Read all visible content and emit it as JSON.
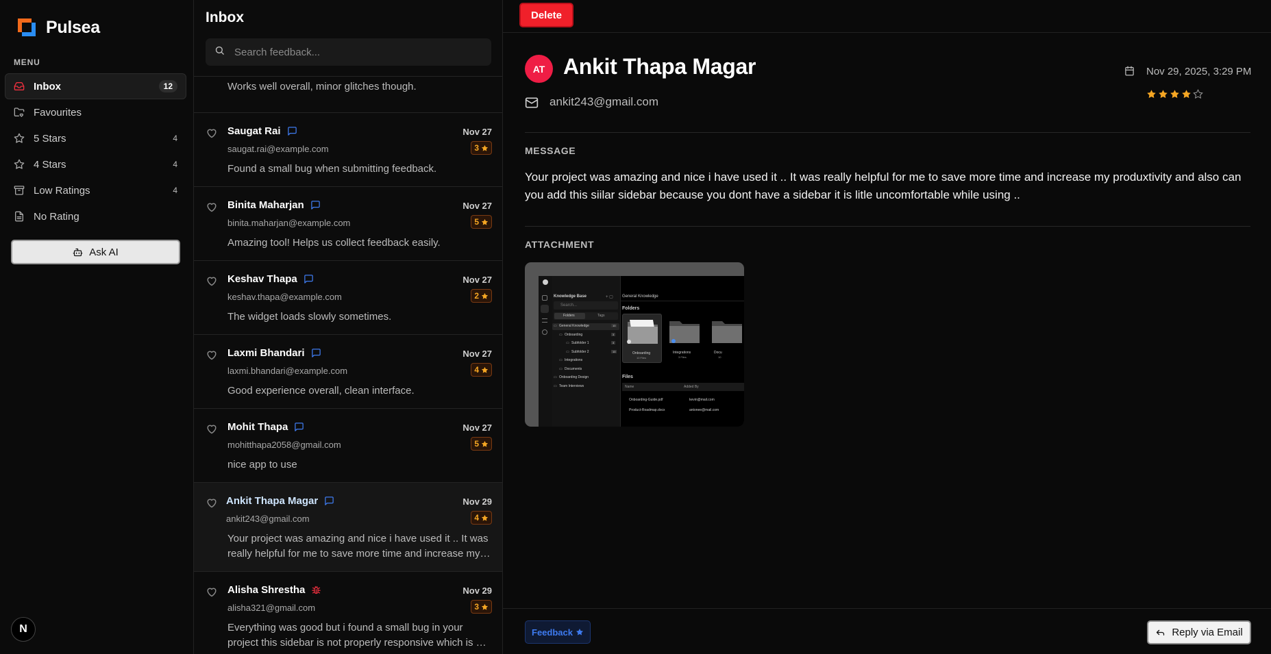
{
  "brand": {
    "name": "Pulsea"
  },
  "sidebar": {
    "menu_label": "MENU",
    "items": [
      {
        "label": "Inbox",
        "count": "12",
        "icon": "inbox-icon",
        "active": true
      },
      {
        "label": "Favourites",
        "count": "",
        "icon": "folder-heart-icon"
      },
      {
        "label": "5 Stars",
        "count": "4",
        "icon": "star-icon"
      },
      {
        "label": "4 Stars",
        "count": "4",
        "icon": "star-icon"
      },
      {
        "label": "Low Ratings",
        "count": "4",
        "icon": "archive-icon"
      },
      {
        "label": "No Rating",
        "count": "",
        "icon": "file-text-icon"
      }
    ],
    "ask_ai_label": "Ask AI",
    "framework_badge": "N"
  },
  "inbox": {
    "title": "Inbox",
    "search_placeholder": "Search feedback...",
    "partial_preview": "Works well overall, minor glitches though.",
    "rows": [
      {
        "name": "Saugat Rai",
        "date": "Nov 27",
        "email": "saugat.rai@example.com",
        "rating": "3",
        "preview": "Found a small bug when submitting feedback.",
        "tag": "feedback"
      },
      {
        "name": "Binita Maharjan",
        "date": "Nov 27",
        "email": "binita.maharjan@example.com",
        "rating": "5",
        "preview": "Amazing tool! Helps us collect feedback easily.",
        "tag": "feedback"
      },
      {
        "name": "Keshav Thapa",
        "date": "Nov 27",
        "email": "keshav.thapa@example.com",
        "rating": "2",
        "preview": "The widget loads slowly sometimes.",
        "tag": "feedback"
      },
      {
        "name": "Laxmi Bhandari",
        "date": "Nov 27",
        "email": "laxmi.bhandari@example.com",
        "rating": "4",
        "preview": "Good experience overall, clean interface.",
        "tag": "feedback"
      },
      {
        "name": "Mohit Thapa",
        "date": "Nov 27",
        "email": "mohitthapa2058@gmail.com",
        "rating": "5",
        "preview": "nice app to use",
        "tag": "feedback"
      },
      {
        "name": "Ankit Thapa Magar",
        "date": "Nov 29",
        "email": "ankit243@gmail.com",
        "rating": "4",
        "preview": "Your project was amazing and nice i have used it .. It was really helpful for me to save more time and increase my produxtivity and also can you add this siilar sidebar",
        "tag": "feedback",
        "selected": true
      },
      {
        "name": "Alisha Shrestha",
        "date": "Nov 29",
        "email": "alisha321@gmail.com",
        "rating": "3",
        "preview": "Everything was good but i found a small bug in your project this sidebar is not properly responsive which is a problem",
        "tag": "bug"
      }
    ]
  },
  "detail": {
    "delete_label": "Delete",
    "initials": "AT",
    "name": "Ankit Thapa Magar",
    "email": "ankit243@gmail.com",
    "date": "Nov 29, 2025, 3:29 PM",
    "rating": 4,
    "rating_max": 5,
    "message_label": "MESSAGE",
    "message": "Your project was amazing and nice i have used it .. It was really helpful for me to save more time and increase my produxtivity and also can you add this siilar sidebar because you dont have a sidebar it is litle uncomfortable while using ..",
    "attachment_label": "ATTACHMENT",
    "type_badge": "Feedback",
    "reply_label": "Reply via Email"
  },
  "attachment_preview": {
    "sidebar_title": "Knowledge Base",
    "search": "Search...",
    "tabs": [
      "Folders",
      "Tags"
    ],
    "tree": [
      {
        "label": "General Knowledge",
        "count": "10"
      },
      {
        "label": "Onboarding",
        "count": "3"
      },
      {
        "label": "Subfolder 1",
        "count": "3"
      },
      {
        "label": "Subfolder 2",
        "count": "10"
      },
      {
        "label": "Integrations",
        "count": ""
      },
      {
        "label": "Documents",
        "count": ""
      },
      {
        "label": "Onboarding Design",
        "count": ""
      },
      {
        "label": "Team Interviews",
        "count": ""
      }
    ],
    "breadcrumb": "General Knowledge",
    "folders_title": "Folders",
    "folders": [
      {
        "name": "Onboarding",
        "meta": "10 Files"
      },
      {
        "name": "Integrations",
        "meta": "3 Files"
      },
      {
        "name": "Docu",
        "meta": "10"
      }
    ],
    "files_title": "Files",
    "file_headers": [
      "Name",
      "Added By"
    ],
    "files": [
      {
        "name": "Onboarding-Guide.pdf",
        "by": "kevin@mail.com"
      },
      {
        "name": "Product-Roadmap.docx",
        "by": "antonee@mail.com"
      }
    ]
  },
  "colors": {
    "accent_red": "#f0202a",
    "star": "#f5a623",
    "link_blue": "#3e7bf0",
    "avatar": "#ef1d45"
  }
}
